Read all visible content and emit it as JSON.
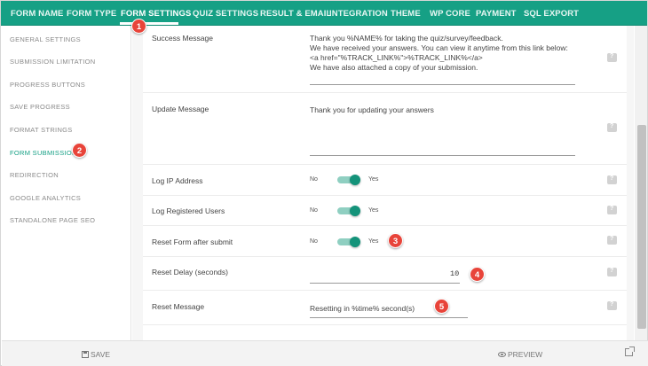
{
  "top_tabs": [
    {
      "label": "FORM NAME",
      "active": false
    },
    {
      "label": "FORM TYPE",
      "active": false
    },
    {
      "label": "FORM SETTINGS",
      "active": true
    },
    {
      "label": "QUIZ SETTINGS",
      "active": false
    },
    {
      "label": "RESULT & EMAIL",
      "active": false
    },
    {
      "label": "INTEGRATION",
      "active": false
    },
    {
      "label": "THEME",
      "active": false
    },
    {
      "label": "WP CORE",
      "active": false
    },
    {
      "label": "PAYMENT",
      "active": false
    },
    {
      "label": "SQL EXPORT",
      "active": false
    }
  ],
  "sidebar": {
    "items": [
      {
        "label": "GENERAL SETTINGS",
        "active": false
      },
      {
        "label": "SUBMISSION LIMITATION",
        "active": false
      },
      {
        "label": "PROGRESS BUTTONS",
        "active": false
      },
      {
        "label": "SAVE PROGRESS",
        "active": false
      },
      {
        "label": "FORMAT STRINGS",
        "active": false
      },
      {
        "label": "FORM SUBMISSION",
        "active": true
      },
      {
        "label": "REDIRECTION",
        "active": false
      },
      {
        "label": "GOOGLE ANALYTICS",
        "active": false
      },
      {
        "label": "STANDALONE PAGE SEO",
        "active": false
      }
    ]
  },
  "settings": {
    "success_message": {
      "label": "Success Message",
      "lines": [
        "Thank you %NAME% for taking the quiz/survey/feedback.",
        "We have received your answers. You can view it anytime from this link below:",
        "<a href=\"%TRACK_LINK%\">%TRACK_LINK%</a>",
        "We have also attached a copy of your submission."
      ]
    },
    "update_message": {
      "label": "Update Message",
      "value": "Thank you for updating your answers"
    },
    "log_ip": {
      "label": "Log IP Address",
      "no": "No",
      "yes": "Yes",
      "on": true
    },
    "log_users": {
      "label": "Log Registered Users",
      "no": "No",
      "yes": "Yes",
      "on": true
    },
    "reset_form": {
      "label": "Reset Form after submit",
      "no": "No",
      "yes": "Yes",
      "on": true
    },
    "reset_delay": {
      "label": "Reset Delay (seconds)",
      "value": "10"
    },
    "reset_message": {
      "label": "Reset Message",
      "value": "Resetting in %time% second(s)"
    }
  },
  "bottom": {
    "save_label": "SAVE",
    "preview_label": "PREVIEW"
  },
  "callouts": [
    "1",
    "2",
    "3",
    "4",
    "5"
  ],
  "colors": {
    "accent": "#16a085",
    "badge": "#e8443a",
    "toggle_on": "#14937a"
  }
}
